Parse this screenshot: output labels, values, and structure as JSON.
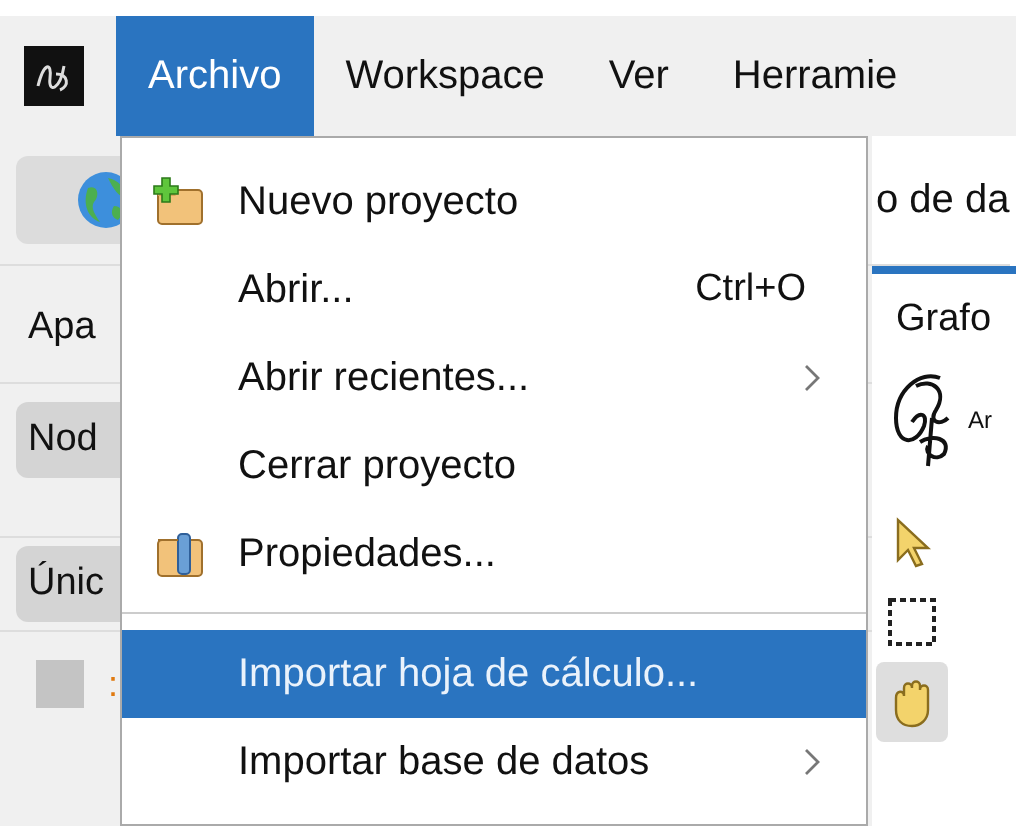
{
  "menubar": {
    "items": [
      {
        "label": "Archivo",
        "selected": true
      },
      {
        "label": "Workspace",
        "selected": false
      },
      {
        "label": "Ver",
        "selected": false
      },
      {
        "label": "Herramie",
        "selected": false
      }
    ]
  },
  "toolbar": {
    "field_text": "o de da"
  },
  "left_panel": {
    "tab": "Apa",
    "button": "Nod",
    "row_button": "Únic",
    "checkbox": {
      "checked": false
    },
    "item_text": ":"
  },
  "right_panel": {
    "tab": "Grafo",
    "logo_text": "Ar",
    "tools": [
      {
        "selected": false
      },
      {
        "selected": false
      },
      {
        "selected": true
      }
    ]
  },
  "menu": {
    "items": [
      {
        "kind": "item",
        "label": "Nuevo proyecto",
        "selected": false
      },
      {
        "kind": "item",
        "label": "Abrir...",
        "shortcut": "Ctrl+O",
        "selected": false
      },
      {
        "kind": "item",
        "label": "Abrir recientes...",
        "submenu": true,
        "selected": false
      },
      {
        "kind": "item",
        "label": "Cerrar proyecto",
        "selected": false
      },
      {
        "kind": "item",
        "label": "Propiedades...",
        "selected": false
      },
      {
        "kind": "separator"
      },
      {
        "kind": "item",
        "label": "Importar hoja de cálculo...",
        "selected": true
      },
      {
        "kind": "item",
        "label": "Importar base de datos",
        "submenu": true,
        "selected": false
      }
    ]
  }
}
